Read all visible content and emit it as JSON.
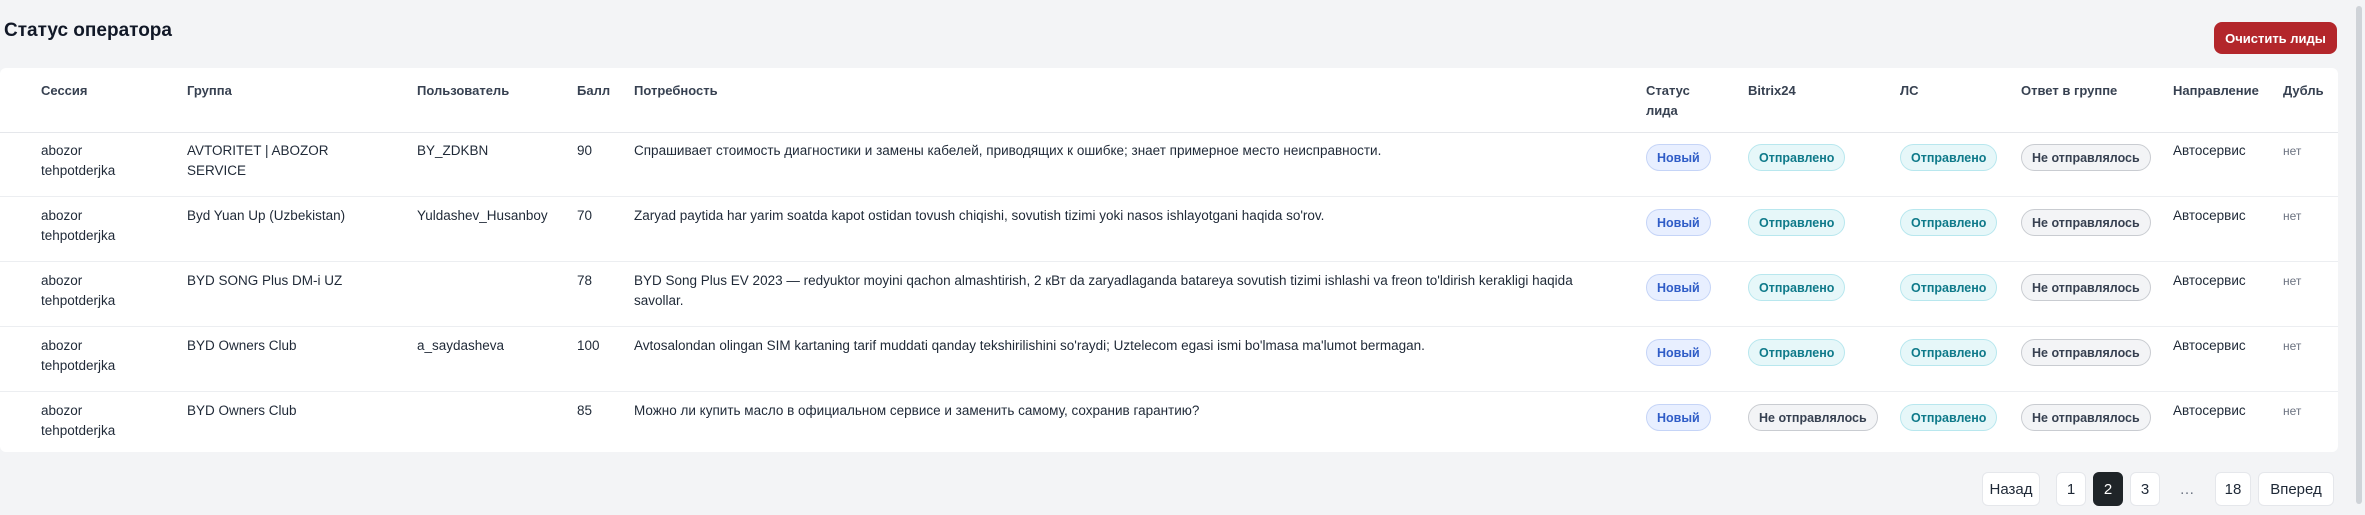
{
  "header": {
    "title": "Статус оператора",
    "clear_button": "Очистить лиды"
  },
  "table": {
    "columns": {
      "session": "Сессия",
      "group": "Группа",
      "user": "Пользователь",
      "score": "Балл",
      "need": "Потребность",
      "status_line1": "Статус",
      "status_line2": "лида",
      "bitrix": "Bitrix24",
      "ls": "ЛС",
      "group_reply": "Ответ в группе",
      "direction": "Направление",
      "dup": "Дубль"
    },
    "rows": [
      {
        "session_1": "abozor",
        "session_2": "tehpotderjka",
        "group_1": "AVTORITET | ABOZOR",
        "group_2": "SERVICE",
        "user": "BY_ZDKBN",
        "score": "90",
        "need_1": "Спрашивает стоимость диагностики и замены кабелей, приводящих к ошибке; знает примерное место неисправности.",
        "need_2": "",
        "status": "Новый",
        "bitrix": "Отправлено",
        "ls": "Отправлено",
        "reply": "Не отправлялось",
        "direction": "Автосервис",
        "dup": "нет"
      },
      {
        "session_1": "abozor",
        "session_2": "tehpotderjka",
        "group_1": "Byd Yuan Up (Uzbekistan)",
        "group_2": "",
        "user": "Yuldashev_Husanboy",
        "score": "70",
        "need_1": "Zaryad paytida har yarim soatda kapot ostidan tovush chiqishi, sovutish tizimi yoki nasos ishlayotgani haqida so'rov.",
        "need_2": "",
        "status": "Новый",
        "bitrix": "Отправлено",
        "ls": "Отправлено",
        "reply": "Не отправлялось",
        "direction": "Автосервис",
        "dup": "нет"
      },
      {
        "session_1": "abozor",
        "session_2": "tehpotderjka",
        "group_1": "BYD SONG Plus DM-i UZ",
        "group_2": "",
        "user": "",
        "score": "78",
        "need_1": "BYD Song Plus EV 2023 — redyuktor moyini qachon almashtirish, 2 кВт da zaryadlaganda batareya sovutish tizimi ishlashi va freon to'ldirish kerakligi haqida",
        "need_2": "savollar.",
        "status": "Новый",
        "bitrix": "Отправлено",
        "ls": "Отправлено",
        "reply": "Не отправлялось",
        "direction": "Автосервис",
        "dup": "нет"
      },
      {
        "session_1": "abozor",
        "session_2": "tehpotderjka",
        "group_1": "BYD Owners Club",
        "group_2": "",
        "user": "a_saydasheva",
        "score": "100",
        "need_1": "Avtosalondan olingan SIM kartaning tarif muddati qanday tekshirilishini so'raydi; Uztelecom egasi ismi bo'lmasa ma'lumot bermagan.",
        "need_2": "",
        "status": "Новый",
        "bitrix": "Отправлено",
        "ls": "Отправлено",
        "reply": "Не отправлялось",
        "direction": "Автосервис",
        "dup": "нет"
      },
      {
        "session_1": "abozor",
        "session_2": "tehpotderjka",
        "group_1": "BYD Owners Club",
        "group_2": "",
        "user": "",
        "score": "85",
        "need_1": "Можно ли купить масло в официальном сервисе и заменить самому, сохранив гарантию?",
        "need_2": "",
        "status": "Новый",
        "bitrix": "Не отправлялось",
        "ls": "Отправлено",
        "reply": "Не отправлялось",
        "direction": "Автосервис",
        "dup": "нет"
      }
    ]
  },
  "pagination": {
    "prev": "Назад",
    "pages": [
      "1",
      "2",
      "3"
    ],
    "current": "2",
    "ellipsis": "…",
    "last": "18",
    "next": "Вперед"
  }
}
